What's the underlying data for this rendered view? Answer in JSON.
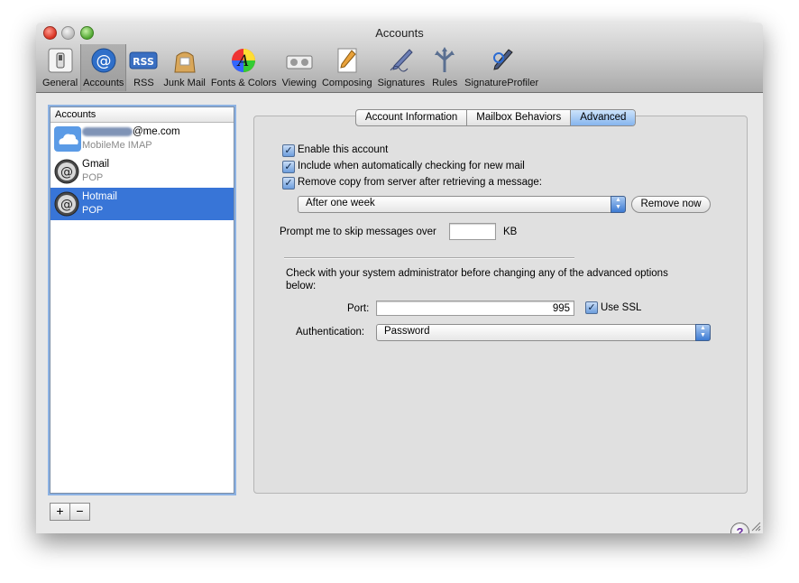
{
  "window": {
    "title": "Accounts"
  },
  "toolbar": {
    "items": [
      {
        "label": "General",
        "icon": "switch-icon"
      },
      {
        "label": "Accounts",
        "icon": "at-sign-icon"
      },
      {
        "label": "RSS",
        "icon": "rss-icon"
      },
      {
        "label": "Junk Mail",
        "icon": "junk-mail-bag-icon"
      },
      {
        "label": "Fonts & Colors",
        "icon": "fonts-colors-icon"
      },
      {
        "label": "Viewing",
        "icon": "viewing-icon"
      },
      {
        "label": "Composing",
        "icon": "composing-pencil-icon"
      },
      {
        "label": "Signatures",
        "icon": "signature-pen-icon"
      },
      {
        "label": "Rules",
        "icon": "rules-arrows-icon"
      },
      {
        "label": "SignatureProfiler",
        "icon": "signature-profiler-icon"
      }
    ],
    "selected": "Accounts"
  },
  "accounts": {
    "header": "Accounts",
    "items": [
      {
        "name": "@me.com",
        "type": "MobileMe IMAP",
        "icon": "mobileme-cloud-icon"
      },
      {
        "name": "Gmail",
        "type": "POP",
        "icon": "mail-at-icon"
      },
      {
        "name": "Hotmail",
        "type": "POP",
        "icon": "mail-at-icon",
        "selected": true
      }
    ],
    "add_label": "+",
    "remove_label": "−"
  },
  "tabs": [
    {
      "label": "Account Information"
    },
    {
      "label": "Mailbox Behaviors"
    },
    {
      "label": "Advanced",
      "active": true
    }
  ],
  "advanced": {
    "enable_account": {
      "label": "Enable this account",
      "checked": true
    },
    "include_check": {
      "label": "Include when automatically checking for new mail",
      "checked": true
    },
    "remove_copy": {
      "label": "Remove copy from server after retrieving a message:",
      "checked": true
    },
    "remove_when": "After one week",
    "remove_now_label": "Remove now",
    "prompt_label": "Prompt me to skip messages over",
    "prompt_value": "",
    "prompt_unit": "KB",
    "admin_note": "Check with your system administrator before changing any of the advanced options below:",
    "port_label": "Port:",
    "port_value": "995",
    "use_ssl": {
      "label": "Use SSL",
      "checked": true
    },
    "auth_label": "Authentication:",
    "auth_value": "Password"
  },
  "help_label": "?",
  "colors": {
    "selection": "#3875d7",
    "tab_active": "#86b5ee"
  }
}
